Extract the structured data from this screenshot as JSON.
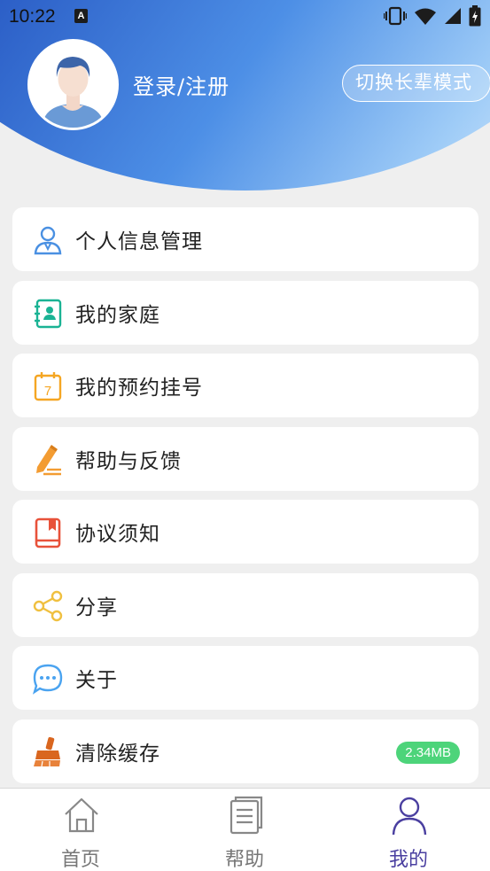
{
  "status_bar": {
    "time": "10:22",
    "notif_letter": "A"
  },
  "header": {
    "login_text": "登录/注册",
    "elder_mode_button": "切换长辈模式"
  },
  "menu": {
    "items": [
      {
        "label": "个人信息管理",
        "icon": "user-icon",
        "color": "#4a90e2"
      },
      {
        "label": "我的家庭",
        "icon": "family-card-icon",
        "color": "#1ab394"
      },
      {
        "label": "我的预约挂号",
        "icon": "calendar-icon",
        "color": "#f5a623"
      },
      {
        "label": "帮助与反馈",
        "icon": "edit-pen-icon",
        "color": "#f39c32"
      },
      {
        "label": "协议须知",
        "icon": "book-icon",
        "color": "#e8523a"
      },
      {
        "label": "分享",
        "icon": "share-icon",
        "color": "#f0c040"
      },
      {
        "label": "关于",
        "icon": "chat-bubble-icon",
        "color": "#4aa3f0"
      },
      {
        "label": "清除缓存",
        "icon": "broom-icon",
        "color": "#d9661f",
        "badge": "2.34MB"
      }
    ]
  },
  "tabbar": {
    "tabs": [
      {
        "label": "首页",
        "icon": "home-icon",
        "active": false
      },
      {
        "label": "帮助",
        "icon": "document-icon",
        "active": false
      },
      {
        "label": "我的",
        "icon": "person-icon",
        "active": true
      }
    ],
    "active_color": "#4a3fa0"
  }
}
